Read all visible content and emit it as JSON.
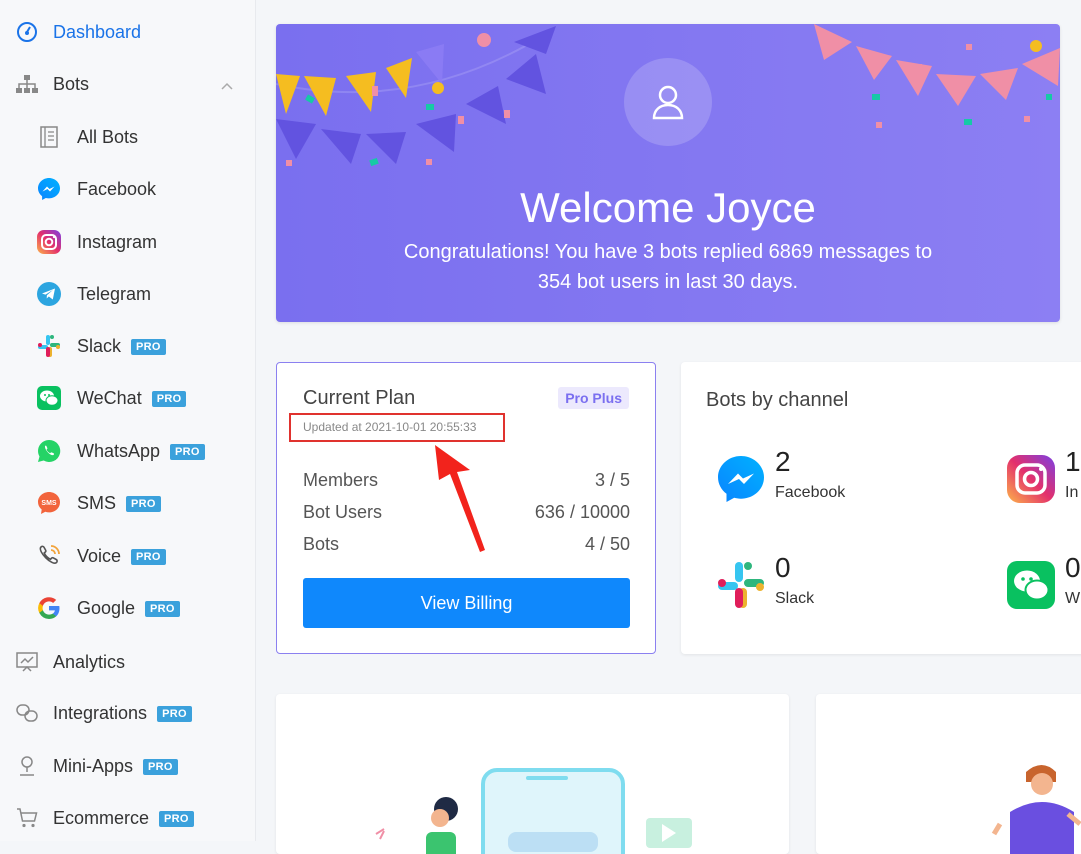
{
  "sidebar": {
    "items": [
      {
        "label": "Dashboard",
        "icon": "dashboard-icon",
        "active": true
      },
      {
        "label": "Bots",
        "icon": "sitemap-icon",
        "expanded": true
      },
      {
        "label": "All Bots",
        "icon": "list-icon"
      },
      {
        "label": "Facebook",
        "icon": "messenger-icon"
      },
      {
        "label": "Instagram",
        "icon": "instagram-icon"
      },
      {
        "label": "Telegram",
        "icon": "telegram-icon"
      },
      {
        "label": "Slack",
        "icon": "slack-icon",
        "badge": "PRO"
      },
      {
        "label": "WeChat",
        "icon": "wechat-icon",
        "badge": "PRO"
      },
      {
        "label": "WhatsApp",
        "icon": "whatsapp-icon",
        "badge": "PRO"
      },
      {
        "label": "SMS",
        "icon": "sms-icon",
        "badge": "PRO"
      },
      {
        "label": "Voice",
        "icon": "voice-icon",
        "badge": "PRO"
      },
      {
        "label": "Google",
        "icon": "google-icon",
        "badge": "PRO"
      },
      {
        "label": "Analytics",
        "icon": "analytics-icon"
      },
      {
        "label": "Integrations",
        "icon": "integrations-icon",
        "badge": "PRO"
      },
      {
        "label": "Mini-Apps",
        "icon": "mini-apps-icon",
        "badge": "PRO"
      },
      {
        "label": "Ecommerce",
        "icon": "cart-icon",
        "badge": "PRO"
      }
    ]
  },
  "hero": {
    "title": "Welcome Joyce",
    "line1": "Congratulations! You have 3 bots replied 6869 messages to",
    "line2": "354 bot users in last 30 days."
  },
  "plan": {
    "title": "Current Plan",
    "badge": "Pro Plus",
    "updated": "Updated at 2021-10-01 20:55:33",
    "rows": [
      {
        "label": "Members",
        "value": "3 / 5"
      },
      {
        "label": "Bot Users",
        "value": "636 / 10000"
      },
      {
        "label": "Bots",
        "value": "4 / 50"
      }
    ],
    "button": "View Billing"
  },
  "channels": {
    "title": "Bots by channel",
    "items": [
      {
        "count": "2",
        "name": "Facebook",
        "icon": "messenger-icon"
      },
      {
        "count": "1",
        "name": "In",
        "icon": "instagram-icon"
      },
      {
        "count": "0",
        "name": "Slack",
        "icon": "slack-icon"
      },
      {
        "count": "0",
        "name": "W",
        "icon": "wechat-icon"
      }
    ]
  },
  "colors": {
    "accent": "#0f88fc",
    "hero": "#7d72f0",
    "pro_badge": "#3ba1dc",
    "highlight": "#e0322e"
  }
}
